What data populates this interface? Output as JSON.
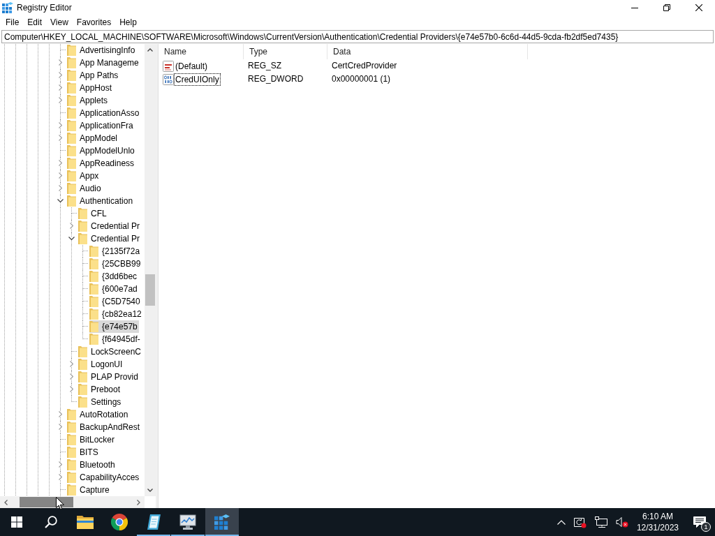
{
  "window": {
    "title": "Registry Editor"
  },
  "menu": [
    "File",
    "Edit",
    "View",
    "Favorites",
    "Help"
  ],
  "address_bar": {
    "value": "Computer\\HKEY_LOCAL_MACHINE\\SOFTWARE\\Microsoft\\Windows\\CurrentVersion\\Authentication\\Credential Providers\\{e74e57b0-6c6d-44d5-9cda-fb2df5ed7435}"
  },
  "tree": {
    "items": [
      {
        "label": "AdvertisingInfo",
        "selected": false
      },
      {
        "label": "App Manageme",
        "expanded": false,
        "selected": false
      },
      {
        "label": "App Paths",
        "expanded": false,
        "selected": false
      },
      {
        "label": "AppHost",
        "expanded": false,
        "selected": false
      },
      {
        "label": "Applets",
        "expanded": false,
        "selected": false
      },
      {
        "label": "ApplicationAsso",
        "selected": false
      },
      {
        "label": "ApplicationFra",
        "expanded": false,
        "selected": false
      },
      {
        "label": "AppModel",
        "expanded": false,
        "selected": false
      },
      {
        "label": "AppModelUnlo",
        "selected": false
      },
      {
        "label": "AppReadiness",
        "expanded": false,
        "selected": false
      },
      {
        "label": "Appx",
        "expanded": false,
        "selected": false
      },
      {
        "label": "Audio",
        "expanded": false,
        "selected": false
      },
      {
        "label": "Authentication",
        "expanded": true,
        "selected": false,
        "children": [
          {
            "label": "CFL",
            "selected": false
          },
          {
            "label": "Credential Pr",
            "expanded": false,
            "selected": false
          },
          {
            "label": "Credential Pr",
            "expanded": true,
            "selected": false,
            "children": [
              {
                "label": "{2135f72a",
                "selected": false
              },
              {
                "label": "{25CBB99",
                "selected": false
              },
              {
                "label": "{3dd6bec",
                "selected": false
              },
              {
                "label": "{600e7ad",
                "selected": false
              },
              {
                "label": "{C5D7540",
                "selected": false
              },
              {
                "label": "{cb82ea12",
                "selected": false
              },
              {
                "label": "{e74e57b",
                "selected": true
              },
              {
                "label": "{f64945df-",
                "selected": false
              }
            ]
          },
          {
            "label": "LockScreenC",
            "selected": false
          },
          {
            "label": "LogonUI",
            "expanded": false,
            "selected": false
          },
          {
            "label": "PLAP Provid",
            "expanded": false,
            "selected": false
          },
          {
            "label": "Preboot",
            "expanded": false,
            "selected": false
          },
          {
            "label": "Settings",
            "selected": false
          }
        ]
      },
      {
        "label": "AutoRotation",
        "expanded": false,
        "selected": false
      },
      {
        "label": "BackupAndRest",
        "expanded": false,
        "selected": false
      },
      {
        "label": "BitLocker",
        "selected": false
      },
      {
        "label": "BITS",
        "selected": false
      },
      {
        "label": "Bluetooth",
        "expanded": false,
        "selected": false
      },
      {
        "label": "CapabilityAcces",
        "expanded": false,
        "selected": false
      },
      {
        "label": "Capture",
        "selected": false
      }
    ]
  },
  "values": {
    "columns": [
      "Name",
      "Type",
      "Data"
    ],
    "rows": [
      {
        "kind": "string",
        "name": "(Default)",
        "type": "REG_SZ",
        "data": "CertCredProvider",
        "selected": false,
        "focused": false
      },
      {
        "kind": "binary",
        "name": "CredUIOnly",
        "type": "REG_DWORD",
        "data": "0x00000001 (1)",
        "selected": false,
        "focused": true
      }
    ]
  },
  "taskbar": {
    "apps": [
      {
        "kind": "folder",
        "running": false,
        "selected": false
      },
      {
        "kind": "browser",
        "running": false,
        "selected": false
      },
      {
        "kind": "notepad",
        "running": true,
        "selected": false
      },
      {
        "kind": "monitor",
        "running": true,
        "selected": false
      },
      {
        "kind": "registry",
        "running": true,
        "selected": true
      }
    ],
    "tray": {
      "volume_muted": true,
      "time": "6:10 AM",
      "date": "12/31/2023",
      "notifications": "1"
    }
  }
}
